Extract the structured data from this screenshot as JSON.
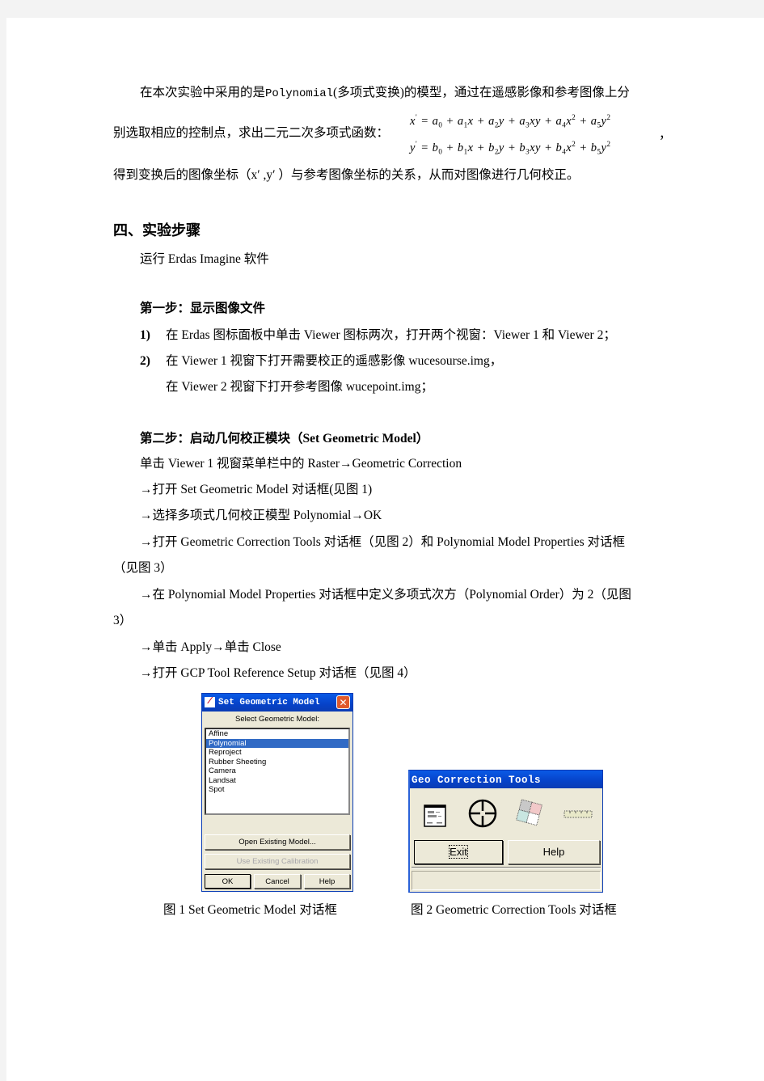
{
  "intro": {
    "line1_prefix": "在本次实验中采用的是",
    "line1_model": "Polynomial",
    "line1_suffix": "(多项式变换)的模型，通过在遥感影像和参考图像上分",
    "line2": "别选取相应的控制点，求出二元二次多项式函数：",
    "formula_x": "x′ = a₀ + a₁x + a₂y + a₃xy + a₄x² + a₅y²",
    "formula_y": "y′ = b₀ + b₁x + b₂y + b₃xy + b₄x² + b₅y²",
    "formula_comma": "，",
    "line3": "得到变换后的图像坐标（x′ ,y′ ）与参考图像坐标的关系，从而对图像进行几何校正。"
  },
  "section": {
    "heading": "四、实验步骤",
    "run_line": "运行 Erdas  Imagine   软件"
  },
  "step1": {
    "heading": "第一步：显示图像文件",
    "items": [
      {
        "num": "1)",
        "text": "在 Erdas 图标面板中单击 Viewer 图标两次，打开两个视窗：Viewer  1 和  Viewer  2；"
      },
      {
        "num": "2)",
        "text": "在 Viewer  1 视窗下打开需要校正的遥感影像 wucesourse.img，"
      }
    ],
    "item2_cont": "在 Viewer  2   视窗下打开参考图像 wucepoint.img；"
  },
  "step2": {
    "heading": "第二步：启动几何校正模块（Set    Geometric    Model）",
    "lines": [
      "单击 Viewer  1 视窗菜单栏中的 Raster→Geometric  Correction",
      "→打开 Set  Geometric  Model   对话框(见图 1)",
      "→选择多项式几何校正模型  Polynomial→OK",
      "→打开 Geometric  Correction  Tools 对话框（见图 2）和 Polynomial  Model  Properties 对话框",
      "（见图 3）",
      "→在 Polynomial  Model  Properties 对话框中定义多项式次方（Polynomial  Order）为 2（见图",
      "3）",
      "→单击 Apply→单击 Close",
      "→打开 GCP  Tool  Reference  Setup   对话框（见图 4）"
    ]
  },
  "figure1": {
    "title": "Set Geometric Model",
    "label": "Select Geometric Model:",
    "models": [
      "Affine",
      "Polynomial",
      "Reproject",
      "Rubber Sheeting",
      "Camera",
      "Landsat",
      "Spot"
    ],
    "selected": "Polynomial",
    "open_existing": "Open Existing Model...",
    "use_existing": "Use Existing Calibration",
    "ok": "OK",
    "cancel": "Cancel",
    "help": "Help",
    "close_glyph": "✕",
    "caption": "图 1    Set  Geometric  Model   对话框"
  },
  "figure2": {
    "title": "Geo Correction Tools",
    "icons": [
      "gcp-table-icon",
      "crosshair-icon",
      "tiles-icon",
      "ruler-icon"
    ],
    "exit": "Exit",
    "help": "Help",
    "caption": "图 2    Geometric  Correction  Tools 对话框"
  }
}
